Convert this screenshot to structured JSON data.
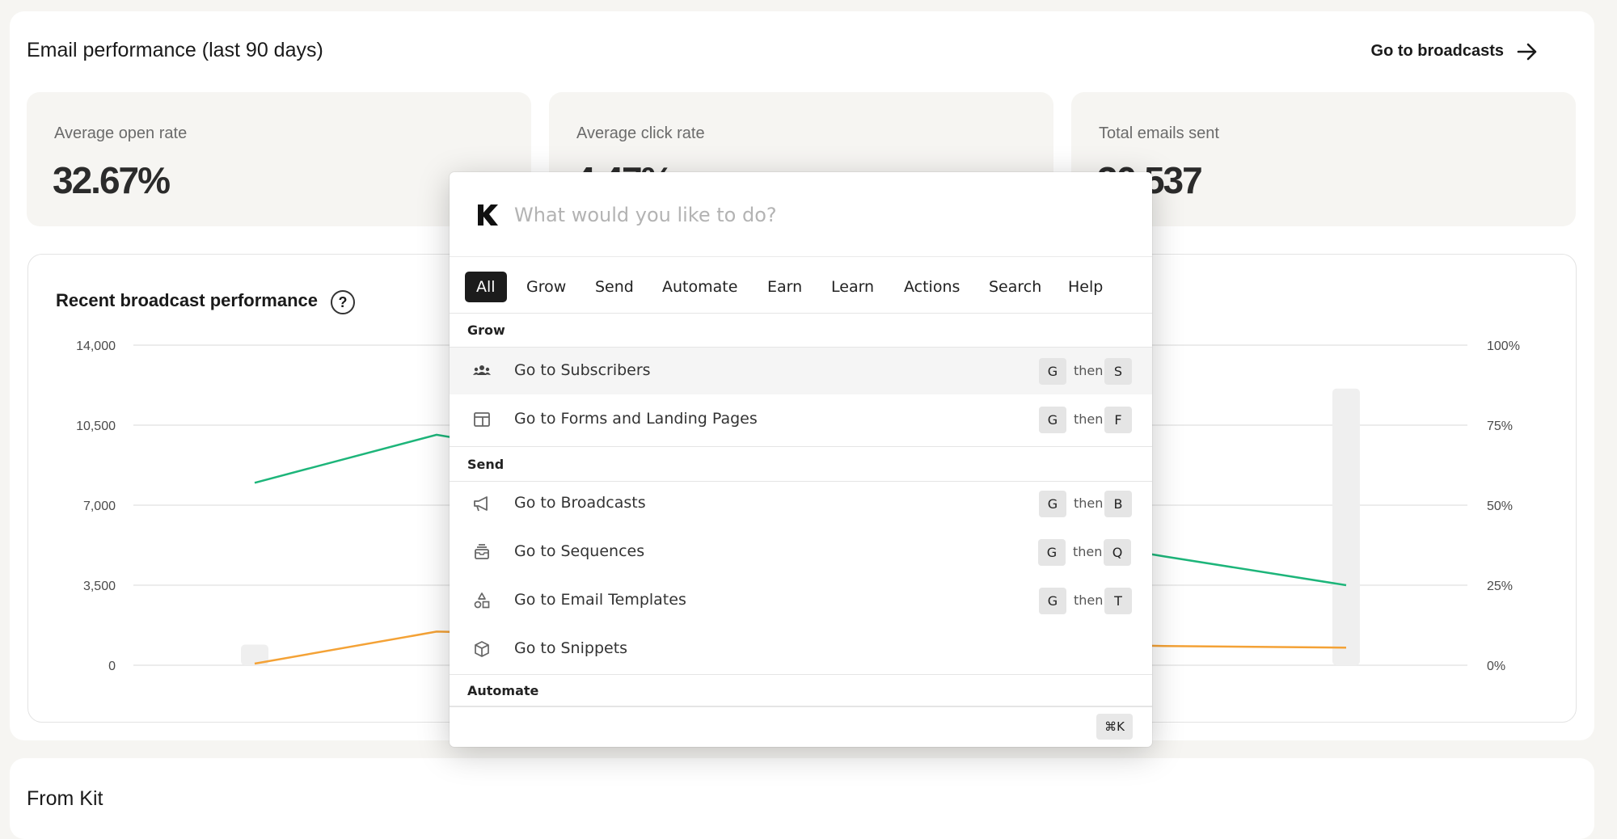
{
  "performance": {
    "title": "Email performance (last 90 days)",
    "goto_label": "Go to broadcasts",
    "stats": [
      {
        "label": "Average open rate",
        "value": "32.67%"
      },
      {
        "label": "Average click rate",
        "value": "4.47%"
      },
      {
        "label": "Total emails sent",
        "value": "30,537"
      }
    ]
  },
  "chart": {
    "title": "Recent broadcast performance",
    "help": "?"
  },
  "chart_data": {
    "type": "bar",
    "left_axis": {
      "ticks": [
        "14,000",
        "10,500",
        "7,000",
        "3,500",
        "0"
      ],
      "ylim": [
        0,
        14000
      ]
    },
    "right_axis": {
      "ticks": [
        "100%",
        "75%",
        "50%",
        "25%",
        "0%"
      ],
      "ylim": [
        0,
        100
      ]
    },
    "grid": true,
    "bars": [
      {
        "x": 1,
        "value": 900
      },
      {
        "x": 10,
        "value": 12100
      }
    ],
    "series": [
      {
        "name": "",
        "color": "#1db57a",
        "axis": "right",
        "points": [
          [
            1,
            57
          ],
          [
            2.5,
            72
          ],
          [
            8.5,
            34
          ],
          [
            10,
            25
          ]
        ]
      },
      {
        "name": "",
        "color": "#f4a236",
        "axis": "right",
        "points": [
          [
            1,
            0.5
          ],
          [
            2.5,
            10.5
          ],
          [
            8.5,
            6
          ],
          [
            10,
            5.5
          ]
        ]
      }
    ],
    "x_range": [
      0,
      11
    ]
  },
  "palette": {
    "placeholder": "What would you like to do?",
    "tabs": [
      "All",
      "Grow",
      "Send",
      "Automate",
      "Earn",
      "Learn",
      "Actions",
      "Search",
      "Help"
    ],
    "active_tab": "All",
    "sections": {
      "grow": "Grow",
      "send": "Send",
      "automate": "Automate"
    },
    "then": "then",
    "items": [
      {
        "label": "Go to Subscribers",
        "key1": "G",
        "key2": "S",
        "icon": "users-icon"
      },
      {
        "label": "Go to Forms and Landing Pages",
        "key1": "G",
        "key2": "F",
        "icon": "layout-icon"
      },
      {
        "label": "Go to Broadcasts",
        "key1": "G",
        "key2": "B",
        "icon": "megaphone-icon"
      },
      {
        "label": "Go to Sequences",
        "key1": "G",
        "key2": "Q",
        "icon": "stack-icon"
      },
      {
        "label": "Go to Email Templates",
        "key1": "G",
        "key2": "T",
        "icon": "shapes-icon"
      },
      {
        "label": "Go to Snippets",
        "icon": "cube-icon"
      }
    ],
    "shortcut": "⌘K"
  },
  "from_kit": {
    "title": "From Kit"
  }
}
